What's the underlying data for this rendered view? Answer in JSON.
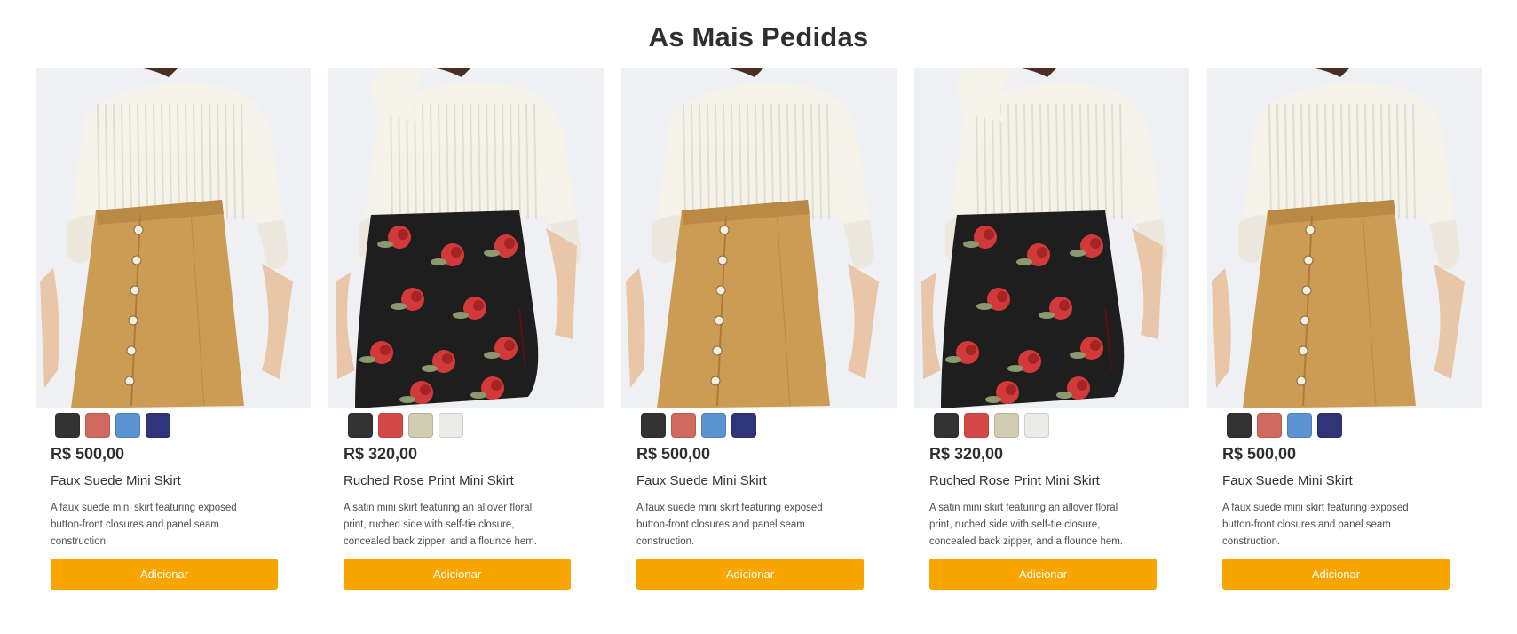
{
  "section": {
    "title": "As Mais Pedidas"
  },
  "products": [
    {
      "kind": "suede",
      "swatches": [
        "#333333",
        "#d0695f",
        "#5b93d3",
        "#303479"
      ],
      "price": "R$ 500,00",
      "name": "Faux Suede Mini Skirt",
      "description": "A faux suede mini skirt featuring exposed button-front closures and panel seam construction.",
      "button": "Adicionar"
    },
    {
      "kind": "floral",
      "swatches": [
        "#333333",
        "#d44848",
        "#d1cbb1",
        "#ebebe7"
      ],
      "price": "R$ 320,00",
      "name": "Ruched Rose Print Mini Skirt",
      "description": "A satin mini skirt featuring an allover floral print, ruched side with self-tie closure, concealed back zipper, and a flounce hem.",
      "button": "Adicionar"
    },
    {
      "kind": "suede",
      "swatches": [
        "#333333",
        "#d0695f",
        "#5b93d3",
        "#303479"
      ],
      "price": "R$ 500,00",
      "name": "Faux Suede Mini Skirt",
      "description": "A faux suede mini skirt featuring exposed button-front closures and panel seam construction.",
      "button": "Adicionar"
    },
    {
      "kind": "floral",
      "swatches": [
        "#333333",
        "#d44848",
        "#d1cbb1",
        "#ebebe7"
      ],
      "price": "R$ 320,00",
      "name": "Ruched Rose Print Mini Skirt",
      "description": "A satin mini skirt featuring an allover floral print, ruched side with self-tie closure, concealed back zipper, and a flounce hem.",
      "button": "Adicionar"
    },
    {
      "kind": "suede",
      "swatches": [
        "#333333",
        "#d0695f",
        "#5b93d3",
        "#303479"
      ],
      "price": "R$ 500,00",
      "name": "Faux Suede Mini Skirt",
      "description": "A faux suede mini skirt featuring exposed button-front closures and panel seam construction.",
      "button": "Adicionar"
    }
  ],
  "colors": {
    "accent": "#f8a500",
    "photo_bg": "#eef0f3"
  }
}
